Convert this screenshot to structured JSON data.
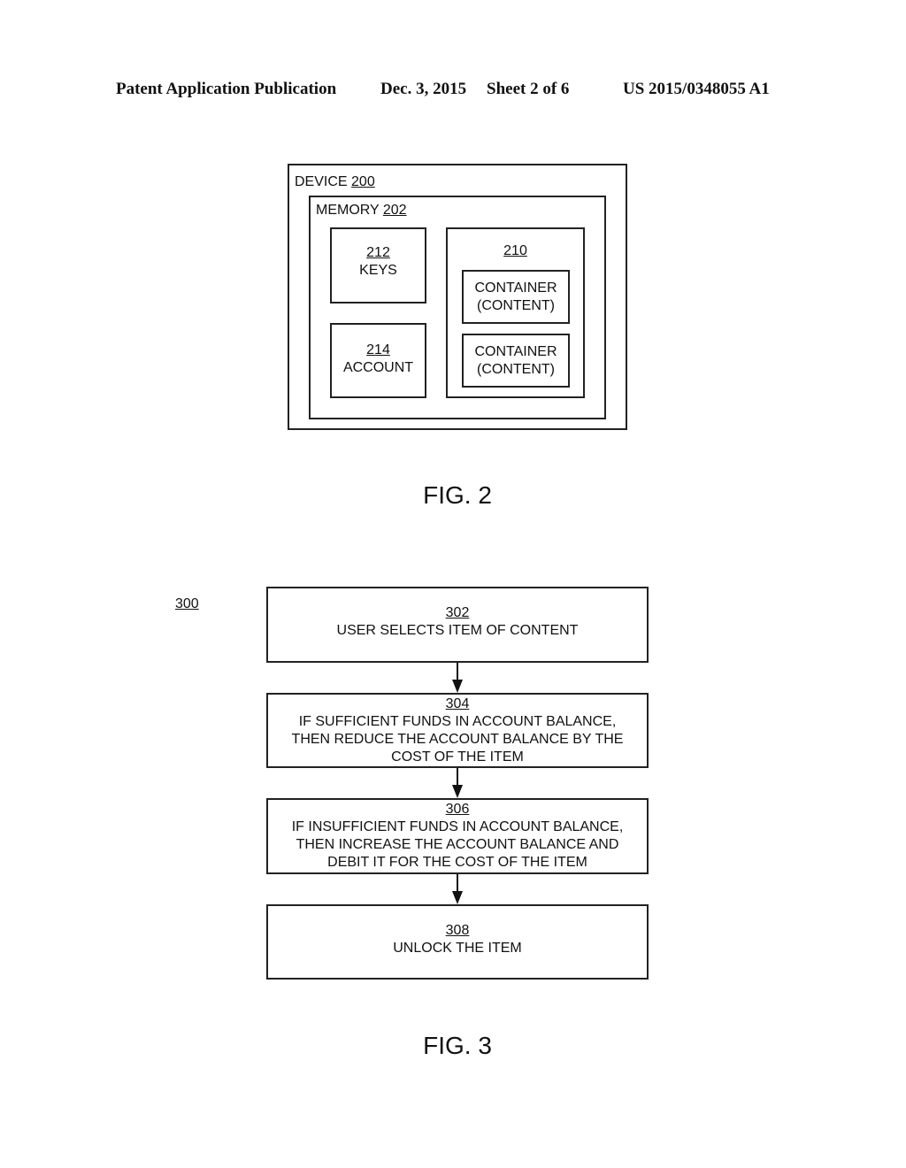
{
  "header": {
    "publication": "Patent Application Publication",
    "date": "Dec. 3, 2015",
    "sheet": "Sheet 2 of 6",
    "number": "US 2015/0348055 A1"
  },
  "fig2": {
    "caption": "FIG. 2",
    "device": {
      "label": "DEVICE",
      "ref": "200"
    },
    "memory": {
      "label": "MEMORY",
      "ref": "202"
    },
    "keys": {
      "ref": "212",
      "label": "KEYS"
    },
    "account": {
      "ref": "214",
      "label": "ACCOUNT"
    },
    "containers_group": {
      "ref": "210"
    },
    "containers": [
      {
        "line1": "CONTAINER",
        "line2": "(CONTENT)"
      },
      {
        "line1": "CONTAINER",
        "line2": "(CONTENT)"
      }
    ]
  },
  "fig3": {
    "caption": "FIG. 3",
    "ref": "300",
    "steps": [
      {
        "ref": "302",
        "lines": [
          "USER SELECTS ITEM OF CONTENT"
        ]
      },
      {
        "ref": "304",
        "lines": [
          "IF SUFFICIENT FUNDS IN ACCOUNT BALANCE,",
          "THEN REDUCE THE ACCOUNT BALANCE BY THE",
          "COST OF THE ITEM"
        ]
      },
      {
        "ref": "306",
        "lines": [
          "IF INSUFFICIENT FUNDS IN ACCOUNT BALANCE,",
          "THEN INCREASE THE ACCOUNT BALANCE AND",
          "DEBIT IT FOR THE COST OF THE ITEM"
        ]
      },
      {
        "ref": "308",
        "lines": [
          "UNLOCK THE ITEM"
        ]
      }
    ]
  }
}
